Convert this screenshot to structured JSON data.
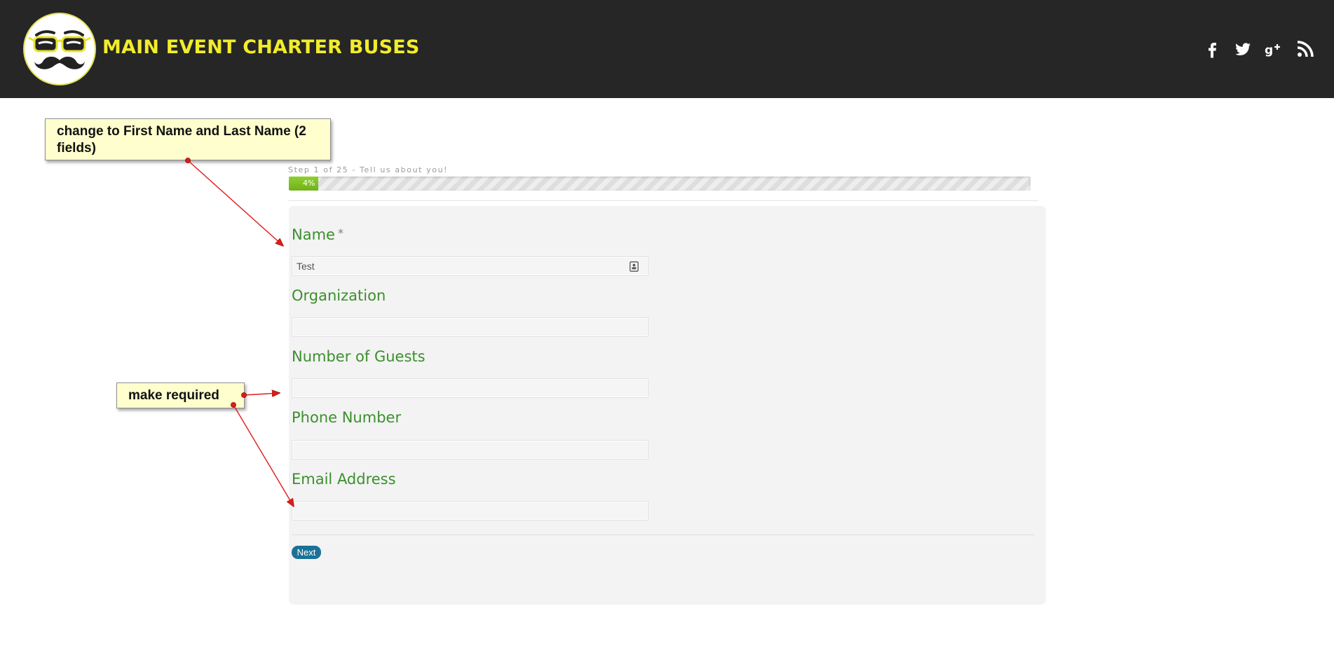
{
  "header": {
    "brand": "MAIN EVENT CHARTER BUSES",
    "logo_icon": "mustache-glasses-logo-icon",
    "social_icons": [
      "facebook-icon",
      "twitter-icon",
      "google-plus-icon",
      "rss-icon"
    ]
  },
  "progress": {
    "step_text": "Step 1 of 25 - Tell us about you!",
    "percent_label": "4%",
    "fraction": 0.04
  },
  "form": {
    "fields": [
      {
        "label": "Name",
        "required_mark": "*",
        "value": "Test"
      },
      {
        "label": "Organization",
        "value": ""
      },
      {
        "label": "Number of Guests",
        "value": ""
      },
      {
        "label": "Phone Number",
        "value": ""
      },
      {
        "label": "Email Address",
        "value": ""
      }
    ],
    "next_label": "Next"
  },
  "annotations": {
    "note_name": "change to First Name and Last Name (2 fields)",
    "note_required": "make required"
  },
  "colors": {
    "header_bg": "#252625",
    "brand_yellow": "#f2ec2b",
    "label_green": "#3b8f2d",
    "progress_green": "#7cc025",
    "button_blue": "#1b7296",
    "note_bg": "#ffffcd",
    "arrow_red": "#e01b1b"
  }
}
